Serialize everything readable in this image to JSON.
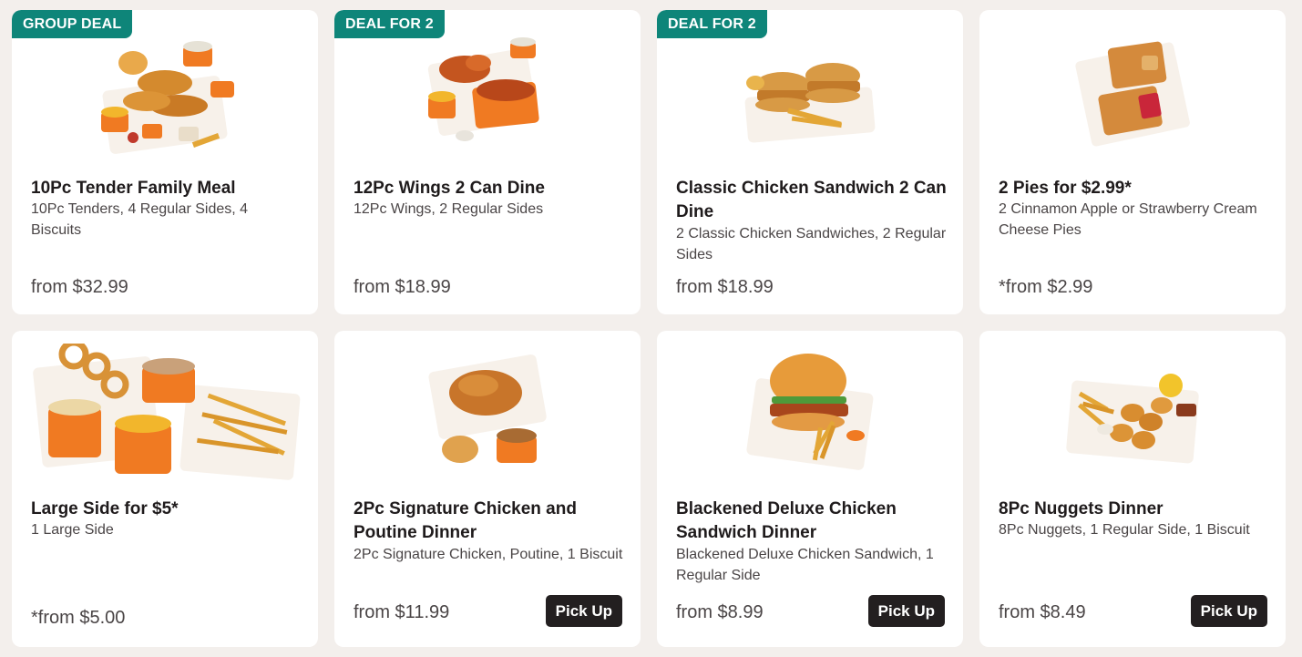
{
  "row1": [
    {
      "badge": "GROUP DEAL",
      "title": "10Pc Tender Family Meal",
      "description": "10Pc Tenders, 4 Regular Sides, 4 Biscuits",
      "price": "from $32.99"
    },
    {
      "badge": "DEAL FOR 2",
      "title": "12Pc Wings 2 Can Dine",
      "description": "12Pc Wings, 2 Regular Sides",
      "price": "from $18.99"
    },
    {
      "badge": "DEAL FOR 2",
      "title": "Classic Chicken Sandwich 2 Can Dine",
      "description": "2 Classic Chicken Sandwiches, 2 Regular Sides",
      "price": "from $18.99"
    },
    {
      "title": "2 Pies for $2.99*",
      "description": "2 Cinnamon Apple or Strawberry Cream Cheese Pies",
      "price": "*from $2.99"
    }
  ],
  "row2": [
    {
      "title": "Large Side for $5*",
      "description": "1 Large Side",
      "price": "*from $5.00"
    },
    {
      "title": "2Pc Signature Chicken and Poutine Dinner",
      "description": "2Pc Signature Chicken, Poutine, 1 Biscuit",
      "price": "from $11.99",
      "action": "Pick Up"
    },
    {
      "title": "Blackened Deluxe Chicken Sandwich Dinner",
      "description": "Blackened Deluxe Chicken Sandwich, 1 Regular Side",
      "price": "from $8.99",
      "action": "Pick Up"
    },
    {
      "title": "8Pc Nuggets Dinner",
      "description": "8Pc Nuggets, 1 Regular Side, 1 Biscuit",
      "price": "from $8.49",
      "action": "Pick Up"
    }
  ],
  "colors": {
    "badge": "#0e8579",
    "button": "#231f20",
    "background": "#f3efec",
    "orange": "#f07a22"
  },
  "icons": [
    "family-meal-image",
    "wings-image",
    "sandwich-combo-image",
    "pies-image",
    "large-side-image",
    "poutine-dinner-image",
    "burger-dinner-image",
    "nuggets-dinner-image"
  ]
}
